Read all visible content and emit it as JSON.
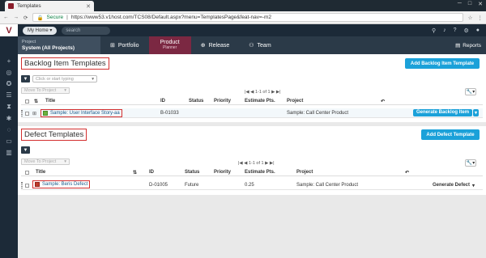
{
  "browser": {
    "tab_title": "Templates",
    "secure_label": "Secure",
    "url": "https://www53.v1host.com/TCS08/Default.aspx?menu=TemplatesPage&feat-nav=-m2",
    "window_controls": [
      "─",
      "□",
      "✕"
    ]
  },
  "header": {
    "my_home": "My Home",
    "search_placeholder": "search",
    "icons": [
      "location-icon",
      "bell-icon",
      "help-icon",
      "settings-icon",
      "user-icon"
    ]
  },
  "project": {
    "label": "Project",
    "name": "System (All Projects)"
  },
  "nav": {
    "portfolio": "Portfolio",
    "product": "Product",
    "product_sub": "Planner",
    "release": "Release",
    "team": "Team",
    "reports": "Reports"
  },
  "backlog": {
    "title": "Backlog Item Templates",
    "add_button": "Add Backlog Item Template",
    "filter_placeholder": "Click or start typing",
    "move_to_project": "Move To Project",
    "pager": "1-1 of 1",
    "columns": [
      "Title",
      "ID",
      "Status",
      "Priority",
      "Estimate Pts.",
      "Project"
    ],
    "rows": [
      {
        "title": "Sample: User Interface Story-aa",
        "id": "B-01033",
        "status": "",
        "priority": "",
        "estimate": "",
        "project": "Sample: Call Center Product",
        "action": "Generate Backlog Item"
      }
    ]
  },
  "defect": {
    "title": "Defect Templates",
    "add_button": "Add Defect Template",
    "move_to_project": "Move To Project",
    "pager": "1-1 of 1",
    "columns": [
      "Title",
      "ID",
      "Status",
      "Priority",
      "Estimate Pts.",
      "Project"
    ],
    "rows": [
      {
        "title": "Sample: Beris Defect",
        "id": "D-01005",
        "status": "Future",
        "priority": "",
        "estimate": "0.25",
        "project": "Sample: Call Center Product",
        "action": "Generate Defect"
      }
    ]
  },
  "colors": {
    "accent": "#1ba1d9",
    "nav_active": "#7b2842",
    "highlight": "#d32f2f"
  }
}
